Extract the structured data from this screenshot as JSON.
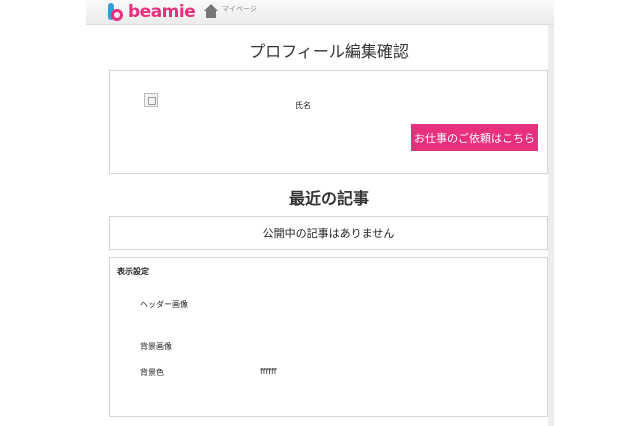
{
  "header": {
    "logo_text": "beamie",
    "home_label": "マイページ"
  },
  "page_title": "プロフィール編集確認",
  "profile": {
    "name_label": "氏名",
    "request_button": "お仕事のご依頼はこちら"
  },
  "recent_articles": {
    "title": "最近の記事",
    "empty_message": "公開中の記事はありません"
  },
  "display_settings": {
    "title": "表示設定",
    "rows": [
      {
        "label": "ヘッダー画像",
        "value": ""
      },
      {
        "label": "背景画像",
        "value": ""
      },
      {
        "label": "背景色",
        "value": "ffffff"
      }
    ]
  },
  "colors": {
    "brand_pink": "#e8307f",
    "brand_blue": "#3a9bd9"
  }
}
